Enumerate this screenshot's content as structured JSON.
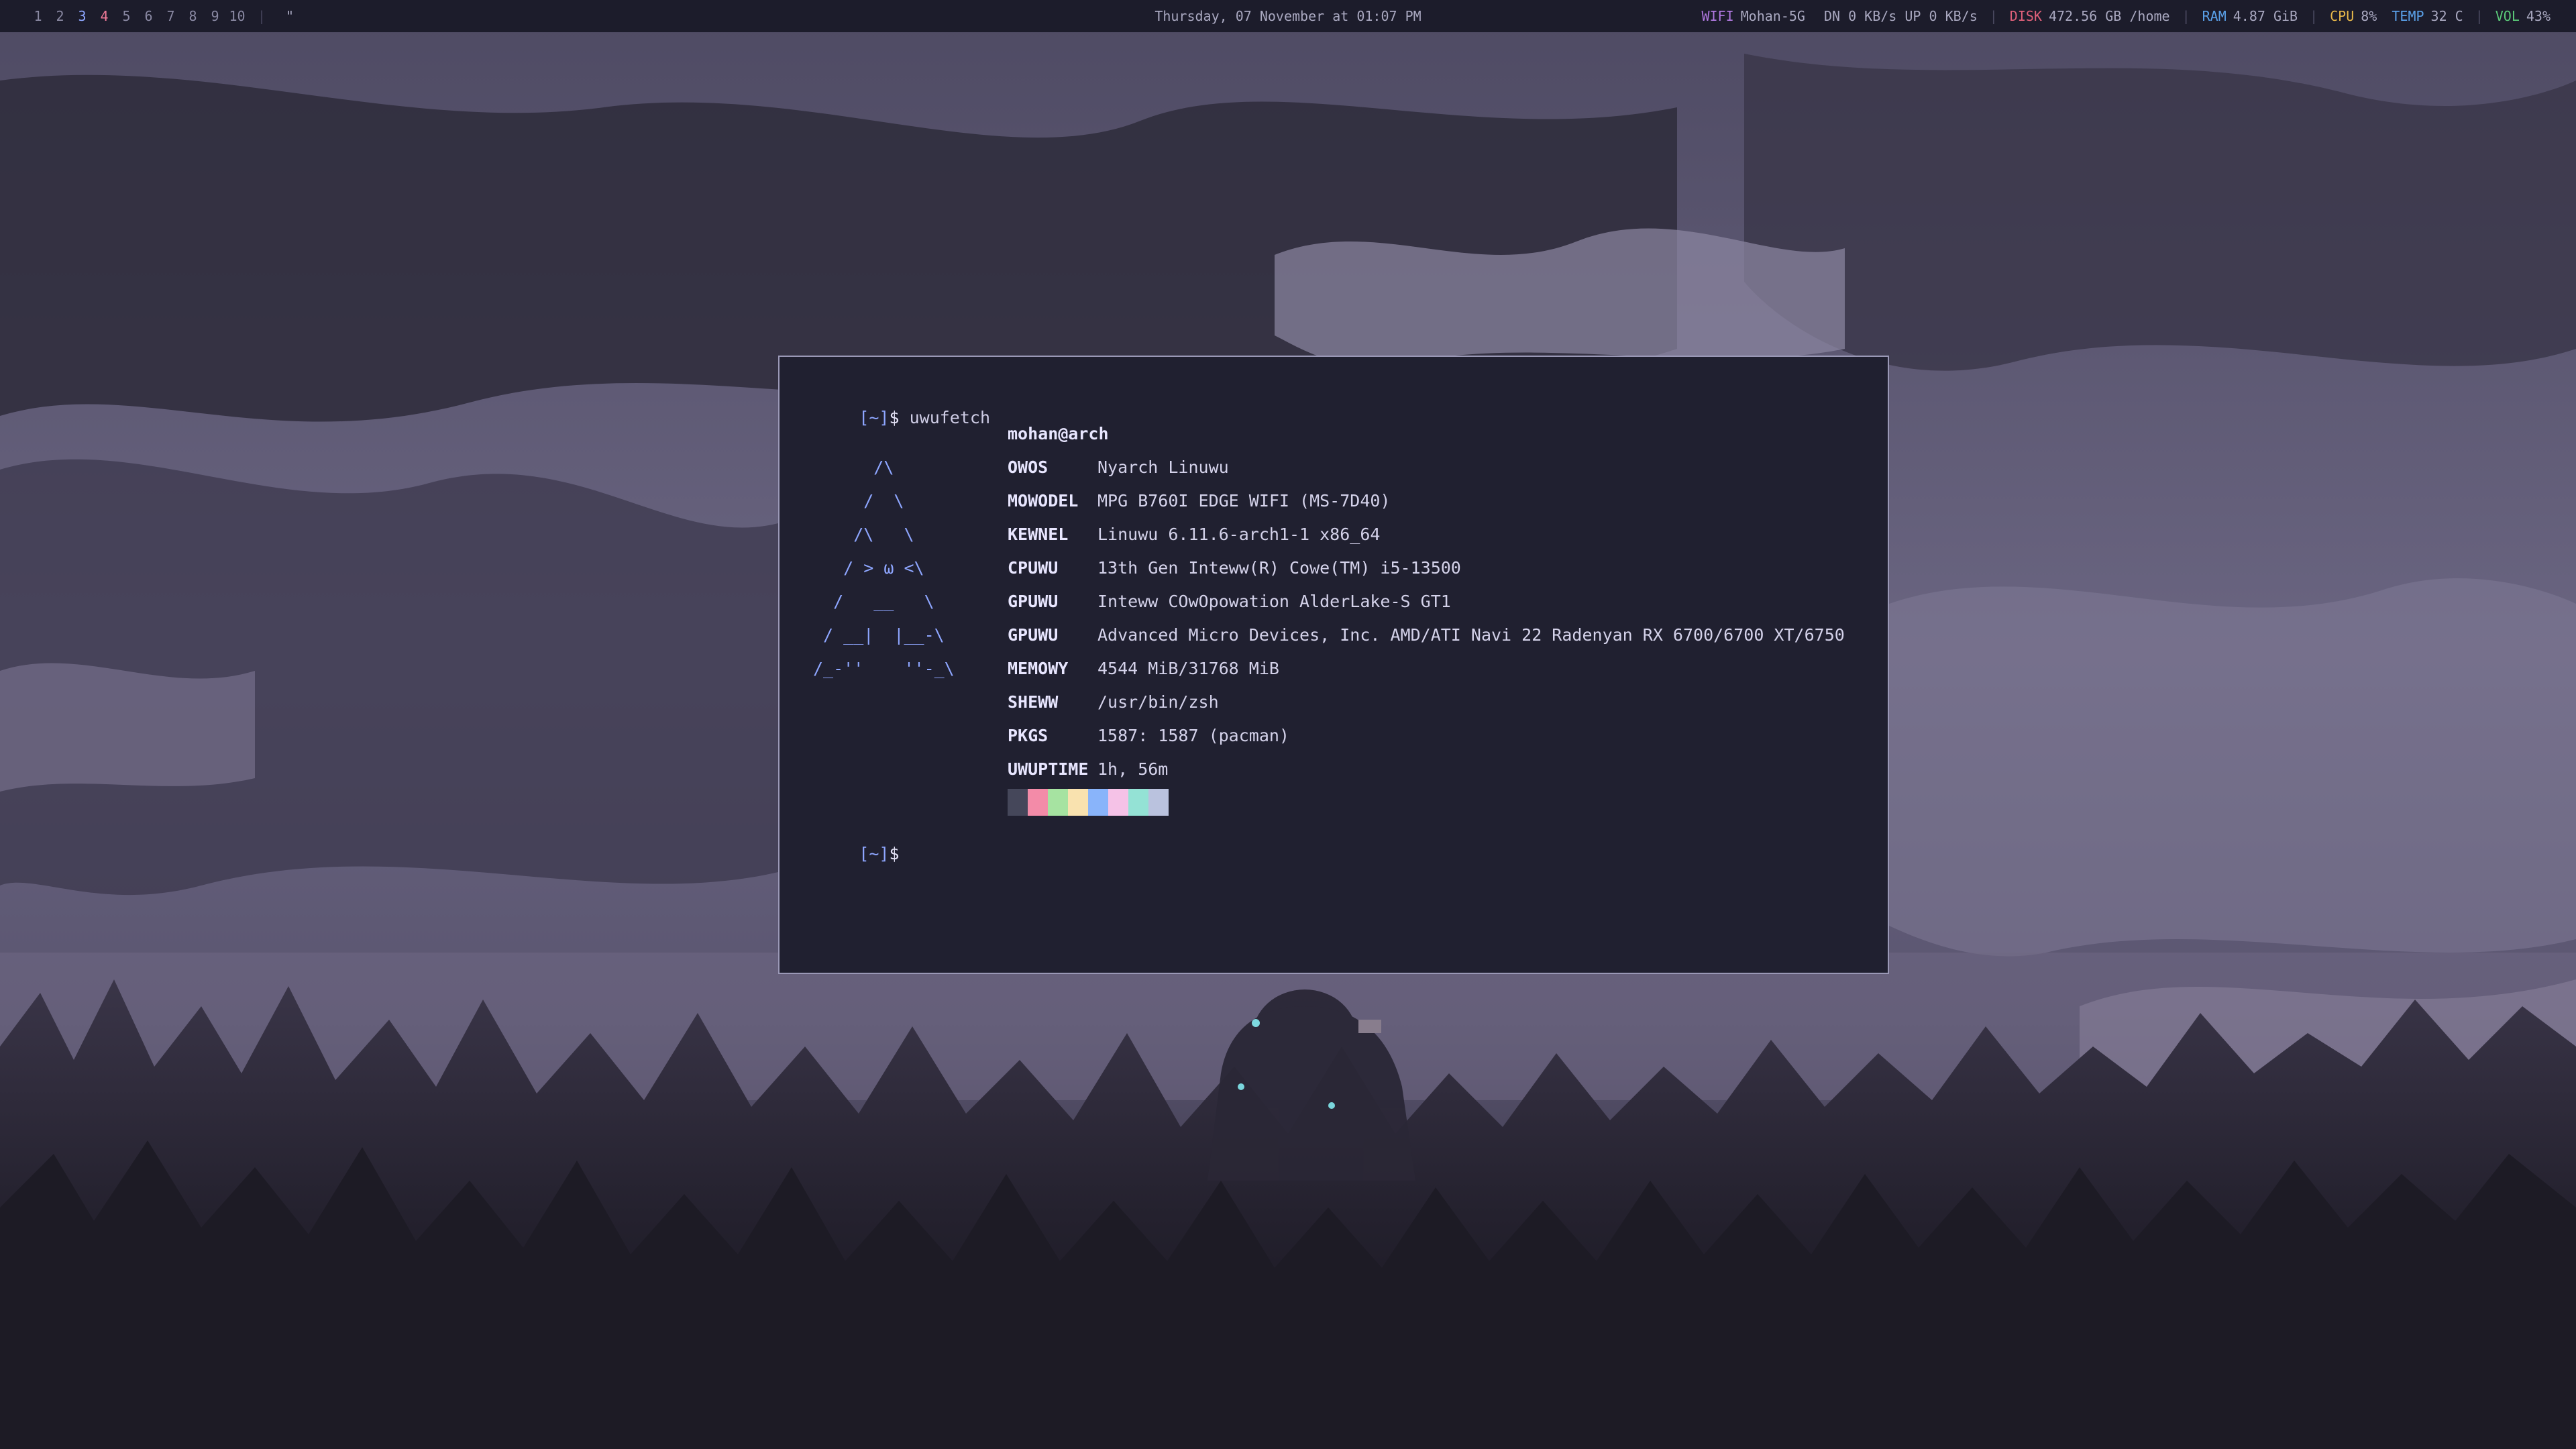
{
  "bar": {
    "workspaces": [
      "1",
      "2",
      "3",
      "4",
      "5",
      "6",
      "7",
      "8",
      "9",
      "10"
    ],
    "active_workspace": "3",
    "urgent_workspace": "4",
    "separator": "|",
    "mode_indicator": "\"",
    "clock": "Thursday, 07 November at 01:07 PM",
    "modules": {
      "wifi_label": "WIFI",
      "wifi_value": "Mohan-5G",
      "net_value": "DN 0 KB/s UP 0 KB/s",
      "disk_label": "DISK",
      "disk_value": "472.56 GB /home",
      "ram_label": "RAM",
      "ram_value": "4.87 GiB",
      "cpu_label": "CPU",
      "cpu_value": "8%",
      "temp_label": "TEMP",
      "temp_value": "32 C",
      "vol_label": "VOL",
      "vol_value": "43%"
    },
    "colors": {
      "wifi": "#b078e0",
      "disk": "#e0607a",
      "ram": "#5aa0e8",
      "cpu": "#e8b84a",
      "temp": "#5aa0e8",
      "vol": "#5ac878"
    }
  },
  "terminal": {
    "prompt_bracket": "[~]",
    "prompt_dollar": "$",
    "command": "uwufetch",
    "ascii_art": "      /\\\n     /  \\\n    /\\   \\\n   / > ω <\\\n  /   __   \\\n / __|  |__-\\\n/_-''    ''-_\\",
    "user_host": "mohan@arch",
    "info": [
      {
        "key": "OWOS",
        "value": "Nyarch Linuwu"
      },
      {
        "key": "MOWODEL",
        "value": "MPG B760I EDGE WIFI (MS-7D40)"
      },
      {
        "key": "KEWNEL",
        "value": "Linuwu 6.11.6-arch1-1 x86_64"
      },
      {
        "key": "CPUWU",
        "value": "13th Gen Inteww(R) Cowe(TM) i5-13500"
      },
      {
        "key": "GPUWU",
        "value": "Inteww COwOpowation AlderLake-S GT1"
      },
      {
        "key": "GPUWU",
        "value": "Advanced Micro Devices, Inc. AMD/ATI Navi 22 Radenyan RX 6700/6700 XT/6750"
      },
      {
        "key": "MEMOWY",
        "value": "4544 MiB/31768 MiB"
      },
      {
        "key": "SHEWW",
        "value": "/usr/bin/zsh"
      },
      {
        "key": "PKGS",
        "value": "1587: 1587 (pacman)"
      },
      {
        "key": "UWUPTIME",
        "value": "1h, 56m"
      }
    ],
    "palette": [
      "#45475a",
      "#f38ba8",
      "#a6e3a1",
      "#f9e2af",
      "#89b4fa",
      "#f5c2e7",
      "#94e2d5",
      "#bac2de"
    ]
  }
}
